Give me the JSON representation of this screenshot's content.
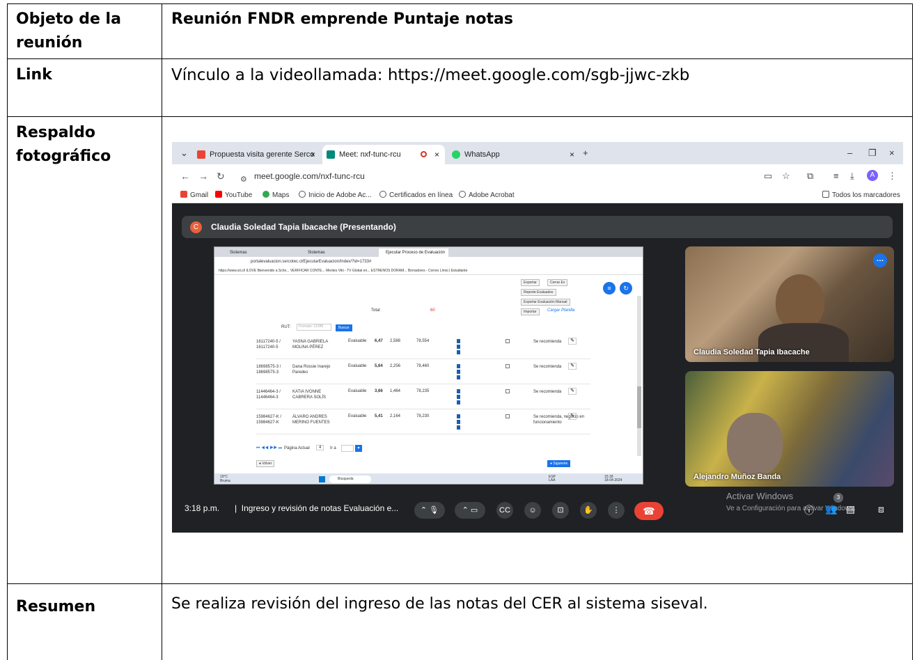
{
  "document": {
    "rows": [
      {
        "label_line1": "Objeto de la",
        "label_line2": "reunión",
        "value": "Reunión FNDR emprende Puntaje notas"
      },
      {
        "label": "Link",
        "value": "Vínculo a la videollamada: https://meet.google.com/sgb-jjwc-zkb"
      },
      {
        "label_line1": "Respaldo",
        "label_line2": "fotográfico"
      },
      {
        "label": "Resumen",
        "value": "Se realiza revisión del ingreso de las notas del CER al sistema siseval."
      }
    ]
  },
  "browser": {
    "tabs": [
      {
        "title": "Propuesta visita gerente Serco",
        "close": "×"
      },
      {
        "title": "Meet: nxf-tunc-rcu",
        "close": "×"
      },
      {
        "title": "WhatsApp",
        "close": "×"
      }
    ],
    "new_tab": "+",
    "url": "meet.google.com/nxf-tunc-rcu",
    "profile_initial": "A",
    "bookmarks": [
      "Gmail",
      "YouTube",
      "Maps",
      "Inicio de Adobe Ac...",
      "Certificados en línea",
      "Adobe Acrobat"
    ],
    "bookmarks_folder": "Todos los marcadores"
  },
  "meet": {
    "presenter_initial": "C",
    "presenter_label": "Claudia Soledad Tapia Ibacache (Presentando)",
    "participants": [
      {
        "name": "Claudia Soledad Tapia Ibacache"
      },
      {
        "name": "Alejandro Muñoz Banda"
      }
    ],
    "clock": "3:18 p.m.",
    "separator": "|",
    "meeting_title": "Ingreso y revisión de notas Evaluación e...",
    "participant_count": "3",
    "watermark_title": "Activar Windows",
    "watermark_sub": "Ve a Configuración para activar Windows."
  },
  "shared_screen": {
    "tabs": [
      "Sistemas",
      "Sistemas",
      "Ejecutar Proceso de Evaluación"
    ],
    "url": "portalevaluacion.sercotec.cl/EjecutarEvaluacion/Index/?id=1733#",
    "bookmarks": "https://www.sii.cl/   ILOVE   Bienvenido a Scho...   VERIFICAR CONTE...   Mentes   Viki - TV Global en...   ESTRENOS DORAM...   Borradores - Correo   Límsi | Estudiante",
    "buttons": {
      "exportar": "Exportar",
      "cerrar": "Cerrar Ev",
      "reporte": "Reporte Evaluados",
      "exportar_manual": "Exportar Evaluación Manual",
      "importar": "Importar",
      "cargar": "Cargar Planilla",
      "buscar": "Buscar",
      "volver": "Volver",
      "siguiente": "Siguiente"
    },
    "total_label": "Total",
    "total_value": "60",
    "rut_label": "RUT:",
    "rut_placeholder": "Formato: 12345",
    "rows": [
      {
        "rut": "16117240-5 /\n16117240-5",
        "name": "YASNA GABRIELA\nMOLINA PÉREZ",
        "status": "Evaluable",
        "score": "6,47",
        "a": "2,588",
        "b": "78,554",
        "rec": "Se recomienda"
      },
      {
        "rut": "18698575-3 /\n18698575-3",
        "name": "Dana Rossie Inarejo\nParedes",
        "status": "Evaluable",
        "score": "5,64",
        "a": "2,256",
        "b": "78,460",
        "rec": "Se recomienda"
      },
      {
        "rut": "11446464-3 /\n11446464-3",
        "name": "KATIA IVONNE\nCABRERA SOLÍS",
        "status": "Evaluable",
        "score": "3,66",
        "a": "1,464",
        "b": "78,235",
        "rec": "Se recomienda"
      },
      {
        "rut": "15984627-K /\n15984627-K",
        "name": "ÁLVARO ANDRES\nMERINO FUENTES",
        "status": "Evaluable",
        "score": "5,41",
        "a": "2,164",
        "b": "78,230",
        "rec": "Se recomienda, negocio en\nfuncionamiento"
      }
    ],
    "pagination": "Página Actual",
    "page_num": "4",
    "ir_a": "Ir a",
    "weather": "19°C\nBruma",
    "search": "Búsqueda",
    "tray": "ESP\nLAA",
    "time": "15:18\n18-04-2024"
  },
  "colors": {
    "meet_bg": "#202124",
    "hangup": "#ea4335",
    "accent": "#1a73e8"
  }
}
